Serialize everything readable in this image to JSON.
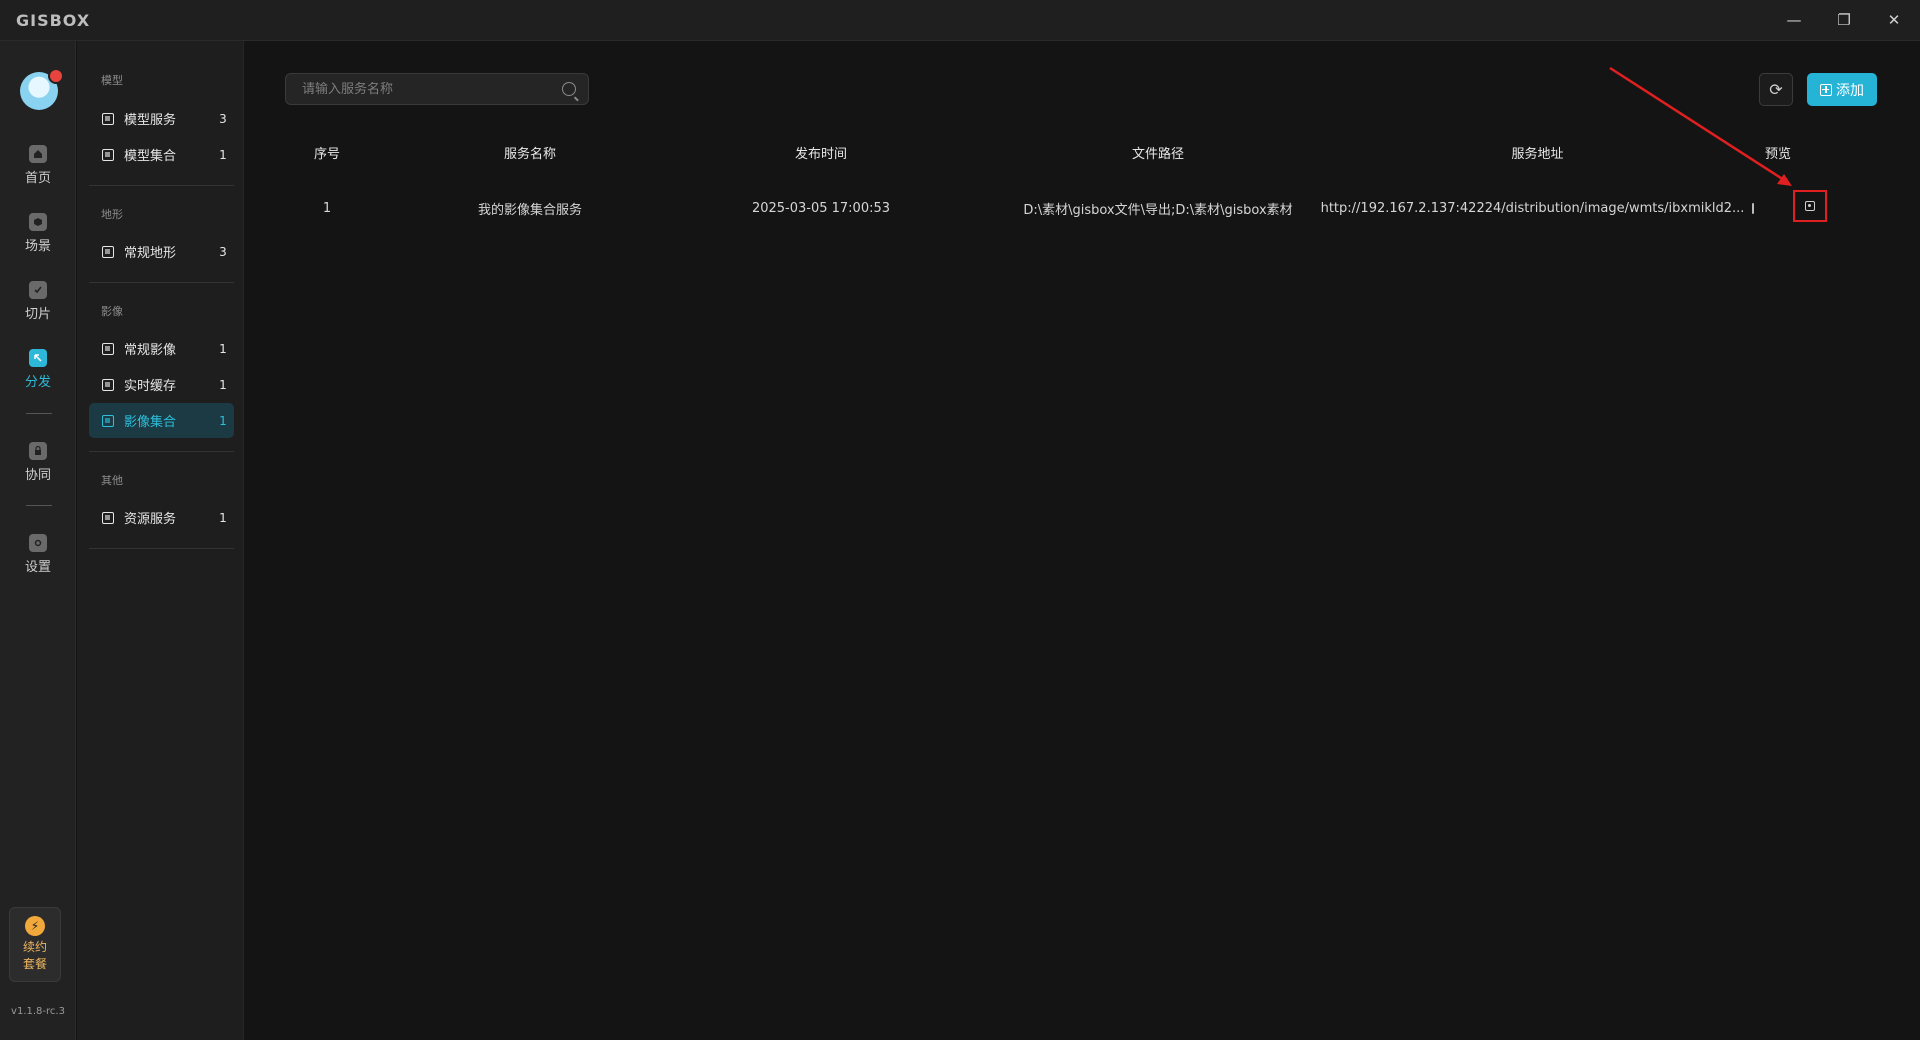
{
  "app": {
    "logo": "GISBOX",
    "version": "v1.1.8-rc.3"
  },
  "window": {
    "minimize": "—",
    "restore": "❐",
    "close": "✕"
  },
  "rail": {
    "items": [
      {
        "label": "首页",
        "icon": "home-icon"
      },
      {
        "label": "场景",
        "icon": "scene-icon"
      },
      {
        "label": "切片",
        "icon": "slice-icon"
      },
      {
        "label": "分发",
        "icon": "distribute-icon",
        "active": true
      },
      {
        "label": "协同",
        "icon": "lock-icon"
      },
      {
        "label": "设置",
        "icon": "settings-icon"
      }
    ],
    "plan_label_line1": "续约",
    "plan_label_line2": "套餐",
    "plan_icon": "⚡"
  },
  "sidenav": {
    "groups": [
      {
        "title": "模型",
        "items": [
          {
            "label": "模型服务",
            "count": "3"
          },
          {
            "label": "模型集合",
            "count": "1"
          }
        ]
      },
      {
        "title": "地形",
        "items": [
          {
            "label": "常规地形",
            "count": "3"
          }
        ]
      },
      {
        "title": "影像",
        "items": [
          {
            "label": "常规影像",
            "count": "1"
          },
          {
            "label": "实时缓存",
            "count": "1"
          },
          {
            "label": "影像集合",
            "count": "1",
            "active": true
          }
        ]
      },
      {
        "title": "其他",
        "items": [
          {
            "label": "资源服务",
            "count": "1"
          }
        ]
      }
    ]
  },
  "toolbar": {
    "search_placeholder": "请输入服务名称",
    "refresh_icon": "⟳",
    "add_label": "添加"
  },
  "table": {
    "headers": [
      "序号",
      "服务名称",
      "发布时间",
      "文件路径",
      "服务地址",
      "预览"
    ],
    "rows": [
      {
        "index": "1",
        "name": "我的影像集合服务",
        "published": "2025-03-05 17:00:53",
        "path": "D:\\素材\\gisbox文件\\导出;D:\\素材\\gisbox素材",
        "address": "http://192.167.2.137:42224/distribution/image/wmts/ibxmikld2..."
      }
    ]
  },
  "colors": {
    "accent": "#25b3d6",
    "annotation": "#e02020",
    "background": "#141414"
  }
}
